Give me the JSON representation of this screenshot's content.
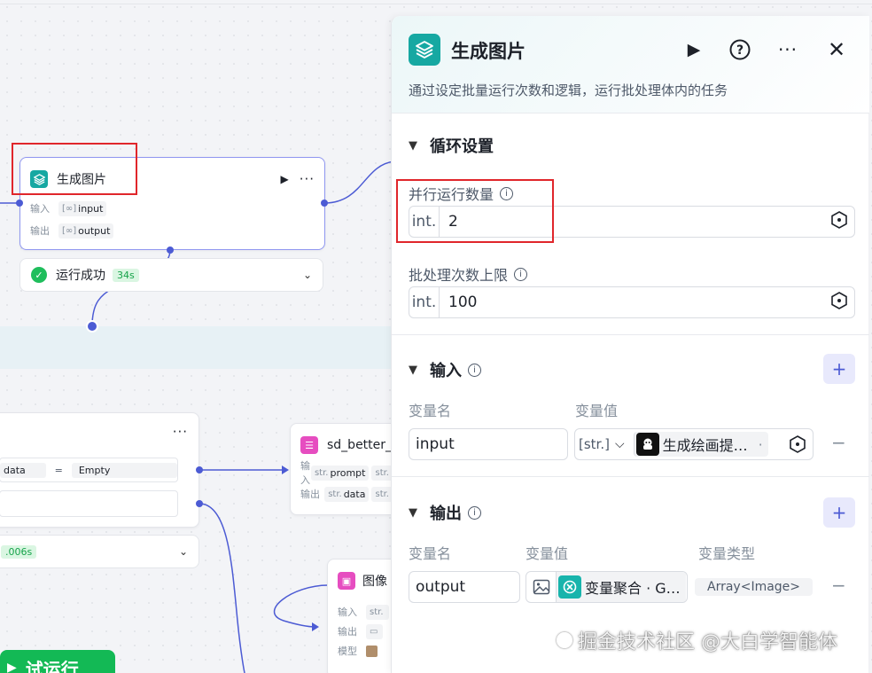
{
  "canvas": {
    "main_node": {
      "title": "生成图片",
      "input_label": "输入",
      "input_value": "input",
      "output_label": "输出",
      "output_value": "output"
    },
    "status": {
      "text": "运行成功",
      "time": "34s"
    },
    "left_node": {
      "field_a": "data",
      "operator": "=",
      "field_b": "Empty",
      "time": ".006s"
    },
    "sd_node": {
      "title": "sd_better_",
      "input_label": "输入",
      "input_type": "str.",
      "input_value": "prompt",
      "input_type2": "str.",
      "output_label": "输出",
      "output_type": "str.",
      "output_value": "data",
      "output_type2": "str."
    },
    "image_node": {
      "title": "图像",
      "input_label": "输入",
      "input_type": "str.",
      "output_label": "输出",
      "model_label": "模型"
    },
    "try_run_label": "试运行"
  },
  "panel": {
    "title": "生成图片",
    "description": "通过设定批量运行次数和逻辑，运行批处理体内的任务",
    "loop_section": {
      "title": "循环设置",
      "parallel": {
        "label": "并行运行数量",
        "prefix": "int.",
        "value": "2"
      },
      "batch_limit": {
        "label": "批处理次数上限",
        "prefix": "int.",
        "value": "100"
      }
    },
    "input_section": {
      "title": "输入",
      "col_name": "变量名",
      "col_value": "变量值",
      "row": {
        "name": "input",
        "type": "[str.]",
        "ref": "生成绘画提…",
        "ref_suffix": "·"
      }
    },
    "output_section": {
      "title": "输出",
      "col_name": "变量名",
      "col_value": "变量值",
      "col_type": "变量类型",
      "row": {
        "name": "output",
        "ref": "变量聚合 · G…",
        "type": "Array<Image>"
      }
    }
  },
  "colors": {
    "accent": "#4c5bd4",
    "brand": "#16a8a2",
    "success": "#1fbe5c",
    "highlight": "#e0262b"
  },
  "watermark": "掘金技术社区 @大白学智能体"
}
